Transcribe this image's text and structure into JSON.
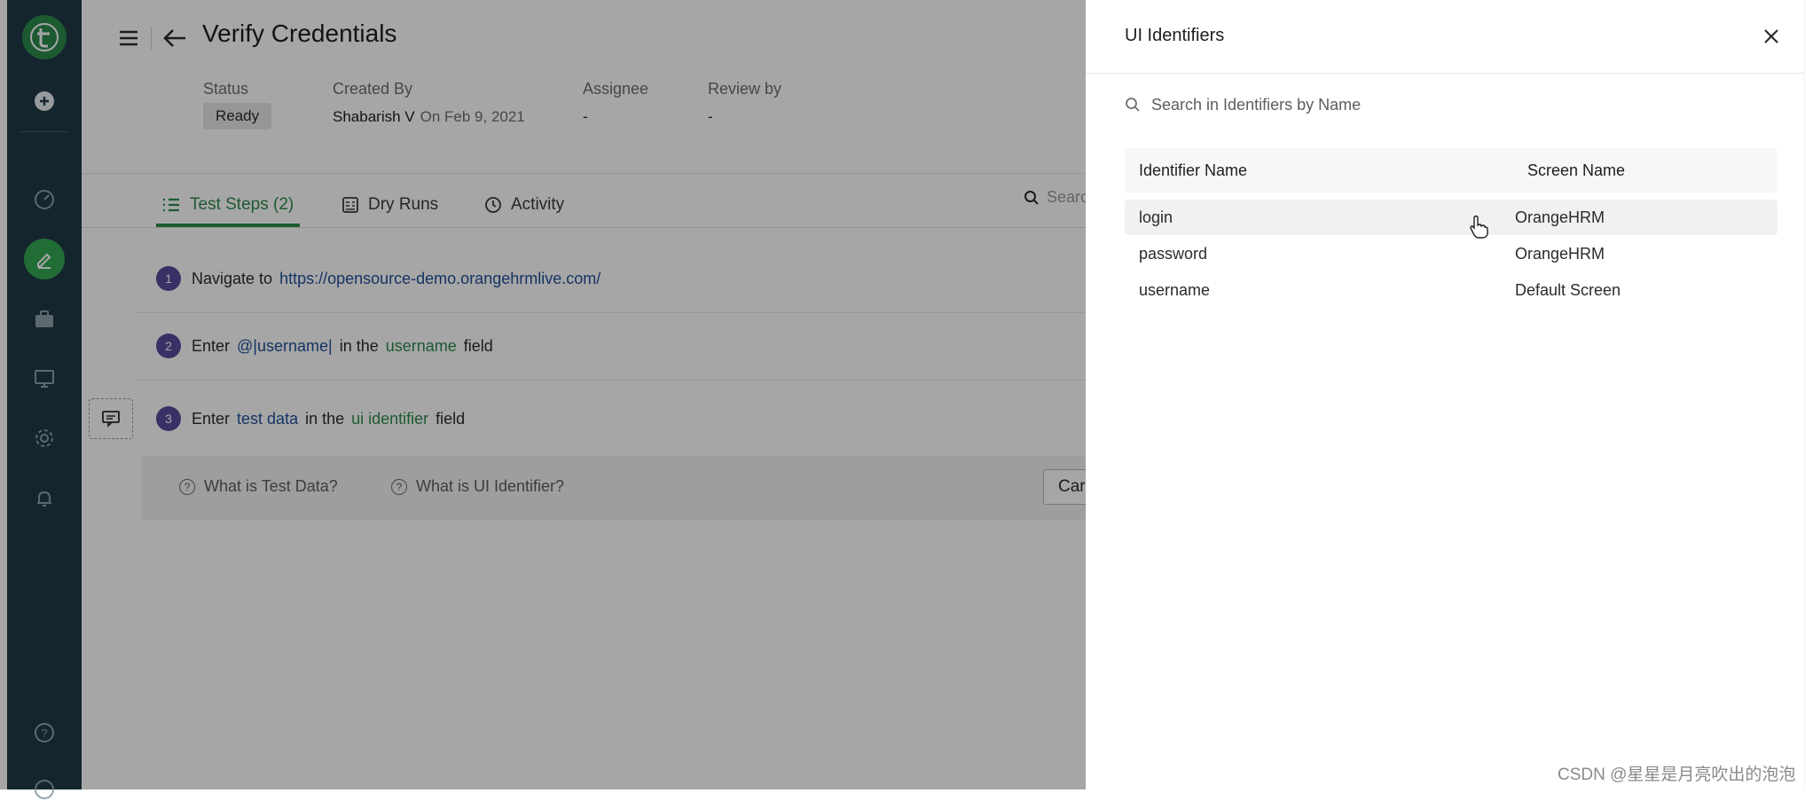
{
  "page": {
    "title": "Verify Credentials"
  },
  "meta": {
    "status_label": "Status",
    "status_value": "Ready",
    "created_by_label": "Created By",
    "created_by_name": "Shabarish V",
    "created_on": "On Feb 9, 2021",
    "assignee_label": "Assignee",
    "assignee_value": "-",
    "review_by_label": "Review by",
    "review_by_value": "-"
  },
  "tabs": [
    {
      "label": "Test Steps (2)",
      "icon": "list-icon",
      "active": true
    },
    {
      "label": "Dry Runs",
      "icon": "dry-runs-icon",
      "active": false
    },
    {
      "label": "Activity",
      "icon": "clock-icon",
      "active": false
    }
  ],
  "search_mini": {
    "placeholder": "Searc"
  },
  "steps": [
    {
      "num": "1",
      "text1": "Navigate to",
      "link": "https://opensource-demo.orangehrmlive.com/"
    },
    {
      "num": "2",
      "text1": "Enter",
      "data": "@|username|",
      "text2": "in the",
      "identifier": "username",
      "text3": "field"
    },
    {
      "num": "3",
      "text1": "Enter",
      "data": "test data",
      "text2": "in the",
      "identifier": "ui identifier",
      "text3": "field"
    }
  ],
  "help": {
    "test_data": "What is Test Data?",
    "ui_identifier": "What is UI Identifier?",
    "cancel": "Car"
  },
  "panel": {
    "title": "UI Identifiers",
    "search_placeholder": "Search in Identifiers by Name",
    "col_identifier": "Identifier Name",
    "col_screen": "Screen Name",
    "rows": [
      {
        "identifier": "login",
        "screen": "OrangeHRM"
      },
      {
        "identifier": "password",
        "screen": "OrangeHRM"
      },
      {
        "identifier": "username",
        "screen": "Default Screen"
      }
    ]
  },
  "watermark": "CSDN @星星是月亮吹出的泡泡",
  "colors": {
    "sidebar": "#1f3a47",
    "accent_green": "#2d8a4e",
    "step_badge": "#5b4a9b",
    "link_blue": "#1f4f9a"
  }
}
